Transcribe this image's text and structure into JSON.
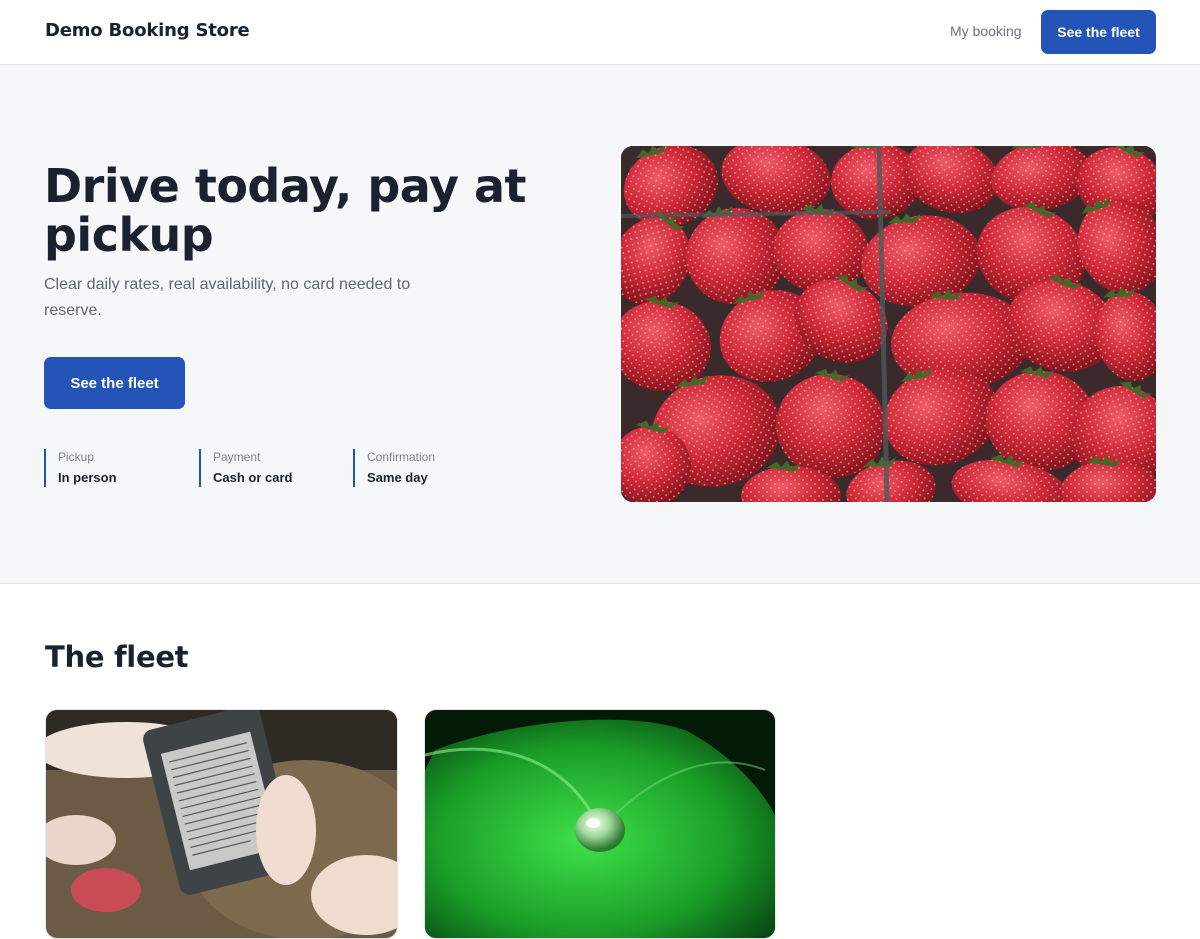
{
  "header": {
    "brand": "Demo Booking Store",
    "nav_link": "My booking",
    "nav_button": "See the fleet"
  },
  "hero": {
    "title": "Drive today, pay at pickup",
    "subtitle": "Clear daily rates, real availability, no card needed to reserve.",
    "cta": "See the fleet",
    "facts": [
      {
        "label": "Pickup",
        "value": "In person"
      },
      {
        "label": "Payment",
        "value": "Cash or card"
      },
      {
        "label": "Confirmation",
        "value": "Same day"
      }
    ],
    "image": "strawberries-photo"
  },
  "fleet": {
    "title": "The fleet",
    "cards": [
      {
        "image": "ereader-photo"
      },
      {
        "image": "leaf-waterdrop-photo"
      }
    ]
  },
  "colors": {
    "accent": "#2554b8",
    "hero_bg": "#f6f7f9",
    "text": "#1a2230",
    "muted": "#5f6773"
  }
}
